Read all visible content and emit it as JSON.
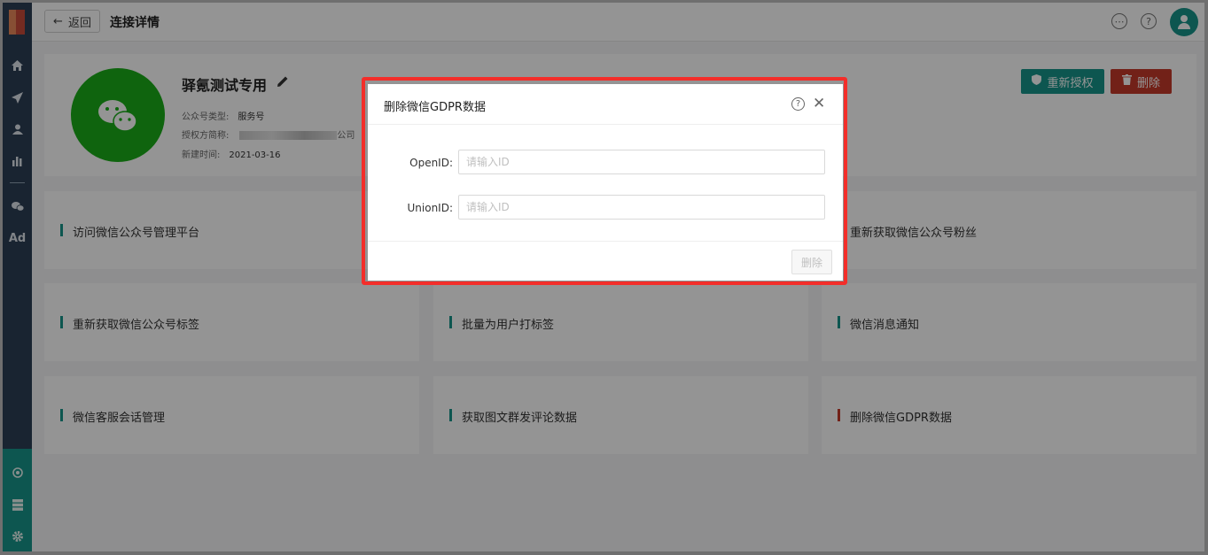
{
  "topbar": {
    "back_label": "返回",
    "page_title": "连接详情"
  },
  "account": {
    "name": "驿氪测试专用",
    "type_label": "公众号类型:",
    "type_value": "服务号",
    "auth_label": "授权方简称:",
    "auth_suffix": "公司",
    "created_label": "新建时间:",
    "created_value": "2021-03-16"
  },
  "actions": {
    "reauth_label": "重新授权",
    "delete_label": "删除"
  },
  "functions": [
    {
      "label": "访问微信公众号管理平台"
    },
    {
      "label": "重新获取微信公众号粉丝"
    },
    {
      "label": "重新获取微信公众号标签"
    },
    {
      "label": "批量为用户打标签"
    },
    {
      "label": "微信消息通知"
    },
    {
      "label": "微信客服会话管理"
    },
    {
      "label": "获取图文群发评论数据"
    },
    {
      "label": "删除微信GDPR数据"
    }
  ],
  "modal": {
    "title": "删除微信GDPR数据",
    "openid_label": "OpenID:",
    "openid_placeholder": "请输入ID",
    "unionid_label": "UnionID:",
    "unionid_placeholder": "请输入ID",
    "delete_label": "删除"
  },
  "colors": {
    "accent": "#18958a",
    "danger": "#c5392a",
    "wechat": "#1aad19",
    "highlight": "#f32e2a"
  }
}
